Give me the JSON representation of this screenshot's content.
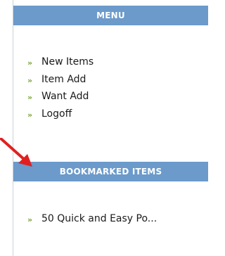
{
  "menu": {
    "title": "MENU",
    "items": [
      {
        "label": "New Items"
      },
      {
        "label": "Item Add"
      },
      {
        "label": "Want Add"
      },
      {
        "label": "Logoff"
      }
    ]
  },
  "bookmarks": {
    "title": "BOOKMARKED ITEMS",
    "items": [
      {
        "label": "50 Quick and Easy Po..."
      }
    ]
  },
  "colors": {
    "header_bg": "#6b9acb",
    "bullet": "#7aa33a",
    "arrow": "#e02020"
  },
  "icons": {
    "bullet": "double-chevron-right-icon",
    "annotation": "red-arrow-icon"
  }
}
